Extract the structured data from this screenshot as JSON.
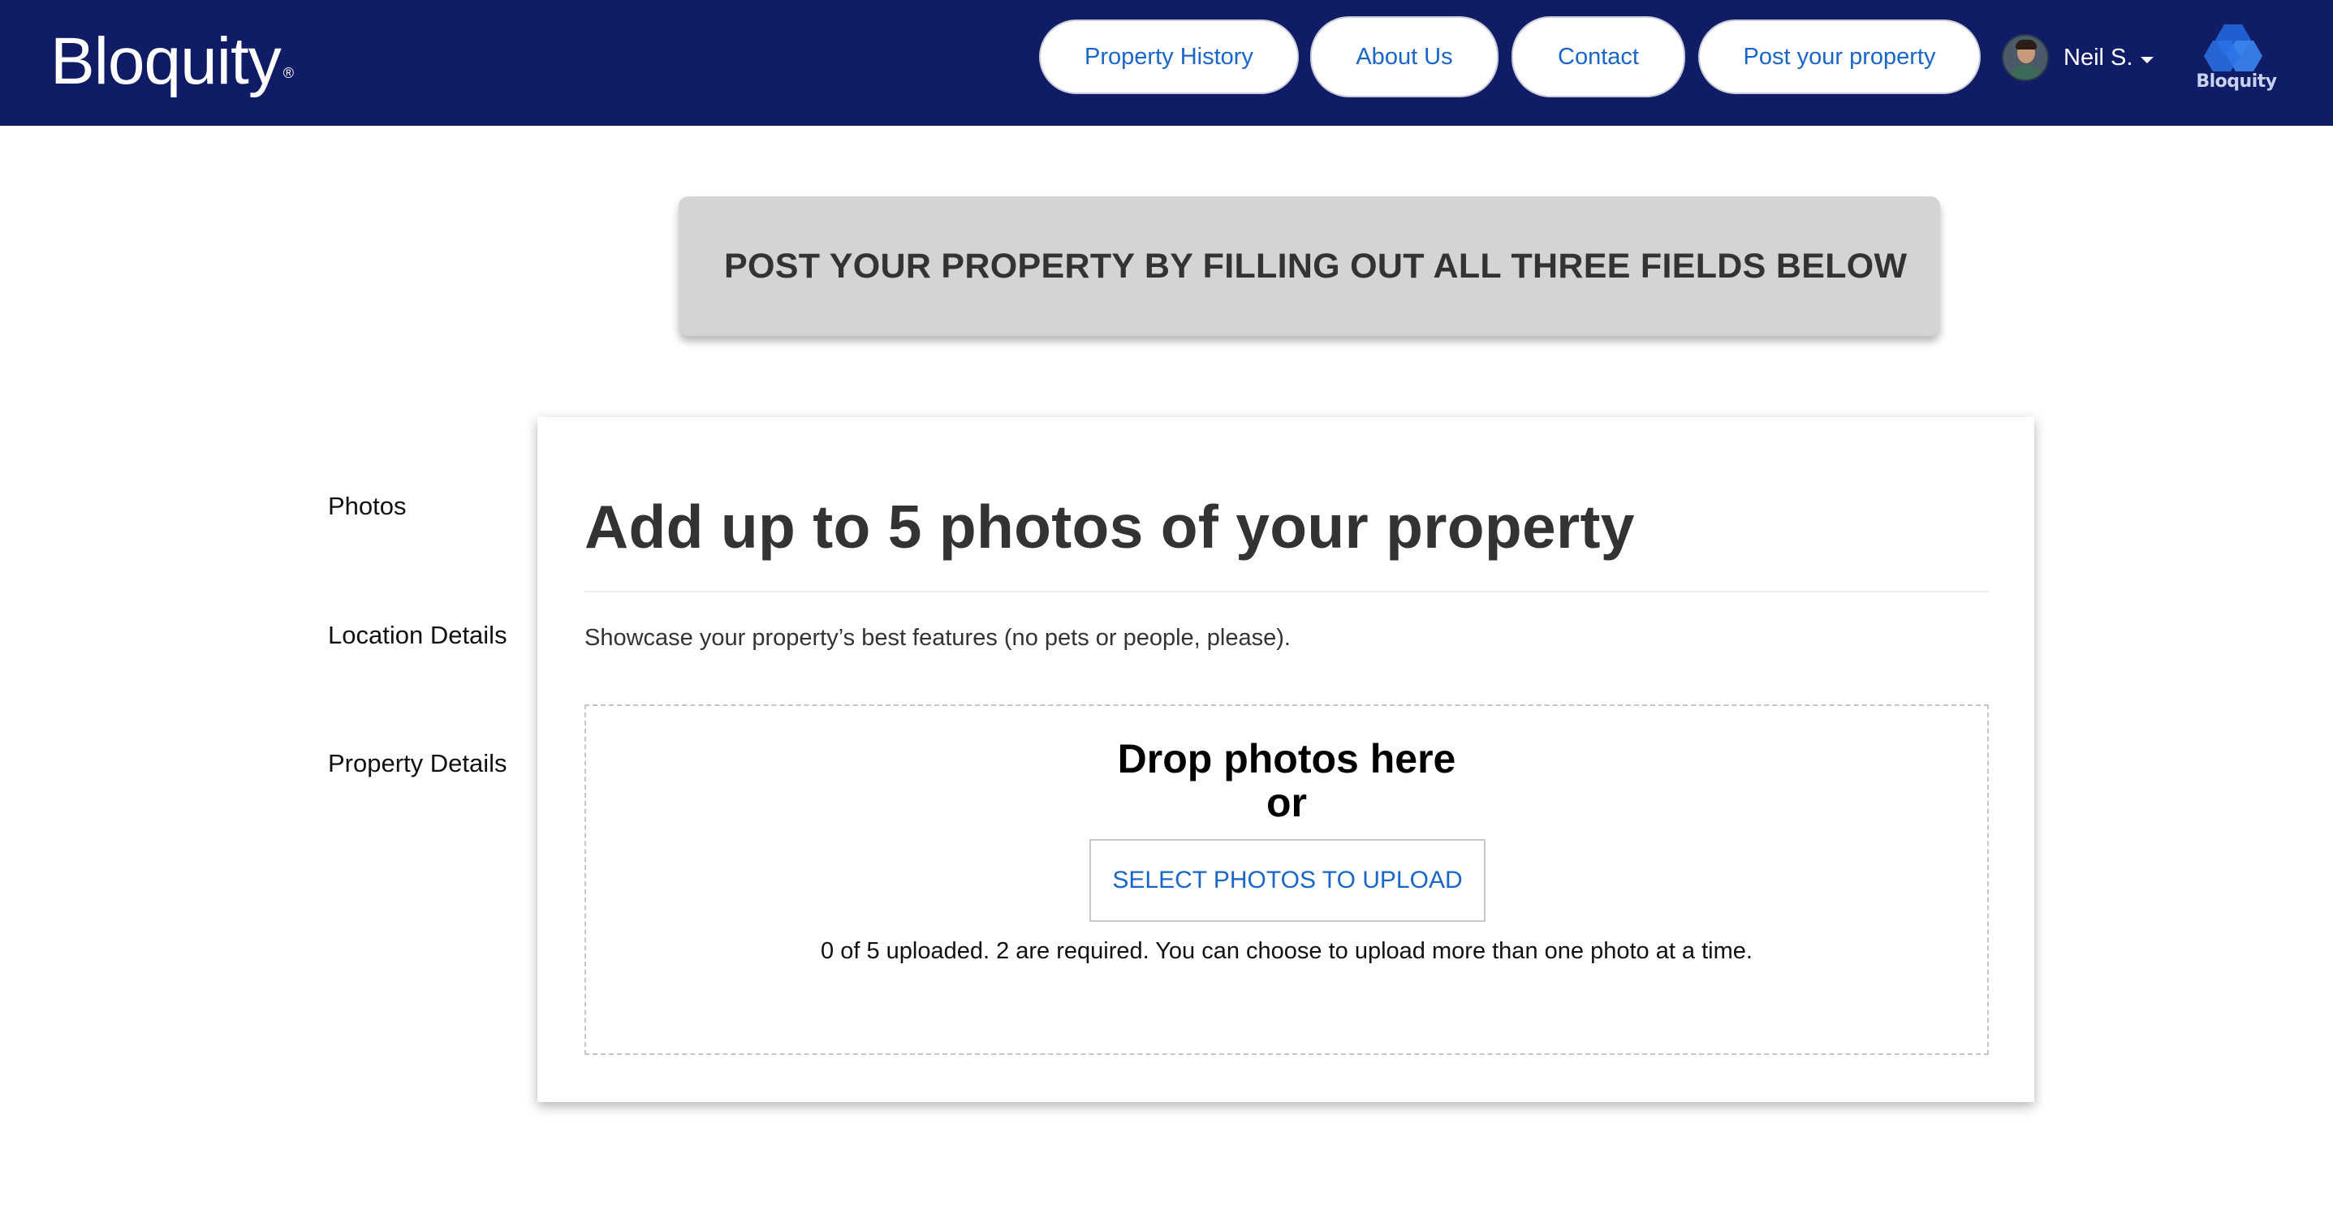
{
  "header": {
    "logo_text": "Bloquity",
    "logo_mark": "®",
    "nav": [
      {
        "label": "Property History"
      },
      {
        "label": "About Us"
      },
      {
        "label": "Contact"
      },
      {
        "label": "Post your property"
      }
    ],
    "user": {
      "name": "Neil S.",
      "avatar_icon": "user-avatar",
      "dropdown_icon": "caret-down-icon"
    },
    "brand_mark": {
      "label": "Bloquity",
      "icon": "hexagon-logo-icon"
    }
  },
  "banner": {
    "text": "POST YOUR PROPERTY BY FILLING OUT ALL THREE FIELDS BELOW"
  },
  "steps": [
    {
      "label": "Photos"
    },
    {
      "label": "Location Details"
    },
    {
      "label": "Property Details"
    }
  ],
  "photos_section": {
    "title": "Add up to 5 photos of your property",
    "subtitle": "Showcase your property’s best features (no pets or people, please).",
    "dropzone": {
      "title_line1": "Drop photos here",
      "title_line2": "or",
      "button_label": "SELECT PHOTOS TO UPLOAD",
      "status": "0 of 5 uploaded. 2 are required. You can choose to upload more than one photo at a time."
    }
  },
  "colors": {
    "header_bg": "#101c66",
    "link_blue": "#1a66c8",
    "banner_bg": "#d4d4d4"
  }
}
